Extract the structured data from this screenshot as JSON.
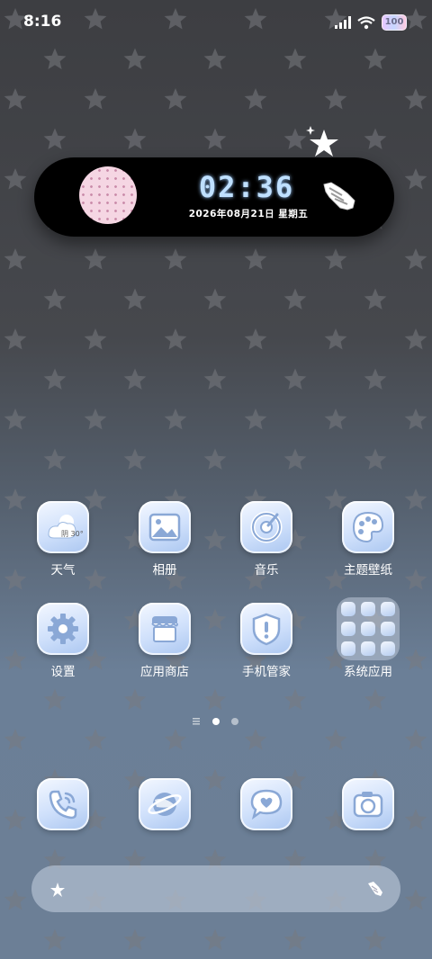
{
  "status": {
    "time": "8:16",
    "battery": "100"
  },
  "widget": {
    "time": "02:36",
    "date": "2026年08月21日 星期五"
  },
  "apps": [
    {
      "label": "天气",
      "icon": "weather-icon",
      "weather_text": "阴 30°"
    },
    {
      "label": "相册",
      "icon": "gallery-icon"
    },
    {
      "label": "音乐",
      "icon": "music-icon"
    },
    {
      "label": "主题壁纸",
      "icon": "theme-palette-icon"
    },
    {
      "label": "设置",
      "icon": "gear-icon"
    },
    {
      "label": "应用商店",
      "icon": "store-icon"
    },
    {
      "label": "手机管家",
      "icon": "shield-icon"
    },
    {
      "label": "系统应用",
      "icon": "folder-icon"
    }
  ],
  "dock": [
    {
      "icon": "phone-icon"
    },
    {
      "icon": "browser-planet-icon"
    },
    {
      "icon": "message-icon"
    },
    {
      "icon": "camera-icon"
    }
  ],
  "pager": {
    "pages": 2,
    "current": 1
  },
  "colors": {
    "widget_time": "#bfe0ff",
    "icon_top": "#f4f8ff",
    "icon_bottom": "#aac6f0"
  }
}
